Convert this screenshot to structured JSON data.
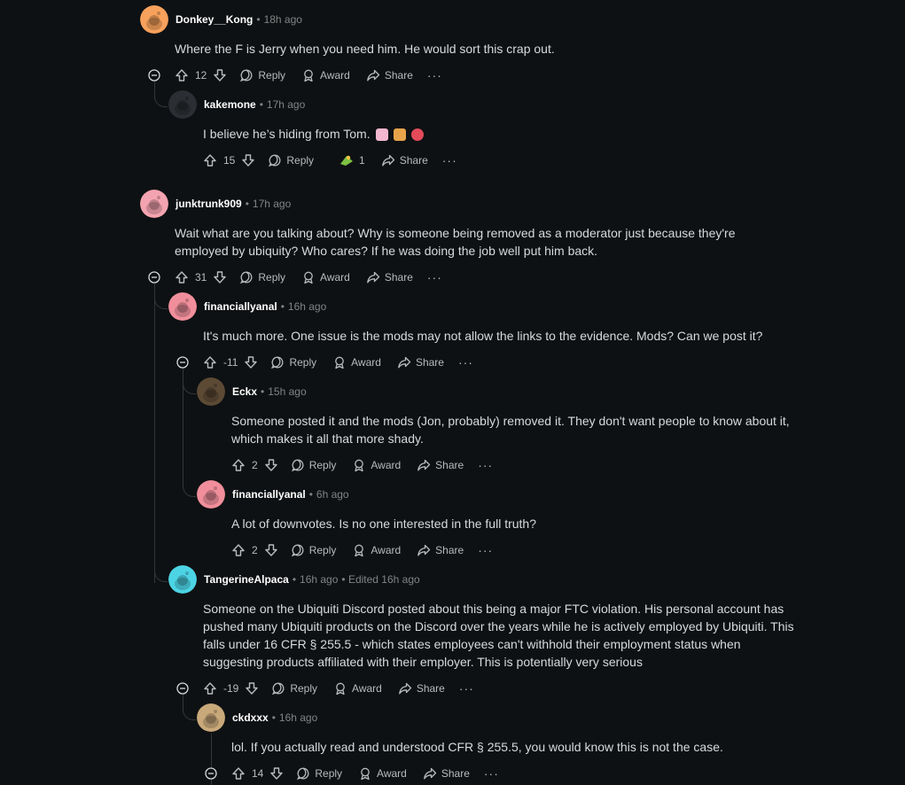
{
  "labels": {
    "reply": "Reply",
    "award": "Award",
    "share": "Share",
    "more": "···"
  },
  "comments": [
    {
      "id": "c1",
      "author": "Donkey__Kong",
      "sep": "•",
      "time": "18h ago",
      "avatar_color": "#f7a15c",
      "body": "Where the F is Jerry when you need him. He would sort this crap out.",
      "votes": "12"
    },
    {
      "id": "c2",
      "author": "kakemone",
      "sep": "•",
      "time": "17h ago",
      "avatar_color": "#2b2f33",
      "body": "I believe he’s hiding from Tom.",
      "votes": "15",
      "award_count": "1"
    },
    {
      "id": "c3",
      "author": "junktrunk909",
      "sep": "•",
      "time": "17h ago",
      "avatar_color": "#f4a4b0",
      "body": "Wait what are you talking about? Why is someone being removed as a moderator just because they're employed by ubiquity? Who cares? If he was doing the job well put him back.",
      "votes": "31"
    },
    {
      "id": "c4",
      "author": "financiallyanal",
      "sep": "•",
      "time": "16h ago",
      "avatar_color": "#f08f9b",
      "body": "It's much more. One issue is the mods may not allow the links to the evidence. Mods? Can we post it?",
      "votes": "-11"
    },
    {
      "id": "c5",
      "author": "Eckx",
      "sep": "•",
      "time": "15h ago",
      "avatar_color": "#5c4a35",
      "body": "Someone posted it and the mods (Jon, probably) removed it. They don't want people to know about it, which makes it all that more shady.",
      "votes": "2"
    },
    {
      "id": "c6",
      "author": "financiallyanal",
      "sep": "•",
      "time": "6h ago",
      "avatar_color": "#f08f9b",
      "body": "A lot of downvotes. Is no one interested in the full truth?",
      "votes": "2"
    },
    {
      "id": "c7",
      "author": "TangerineAlpaca",
      "sep": "•",
      "time": "16h ago",
      "edited": "• Edited 16h ago",
      "avatar_color": "#4cd4e4",
      "body": "Someone on the Ubiquiti Discord posted about this being a major FTC violation. His personal account has pushed many Ubiquiti products on the Discord over the years while he is actively employed by Ubiquiti. This falls under 16 CFR § 255.5 - which states employees can't withhold their employment status when suggesting products affiliated with their employer. This is potentially very serious",
      "votes": "-19"
    },
    {
      "id": "c8",
      "author": "ckdxxx",
      "sep": "•",
      "time": "16h ago",
      "avatar_color": "#c9a97a",
      "body": "lol. If you actually read and understood CFR § 255.5, you would know this is not the case.",
      "votes": "14"
    }
  ]
}
